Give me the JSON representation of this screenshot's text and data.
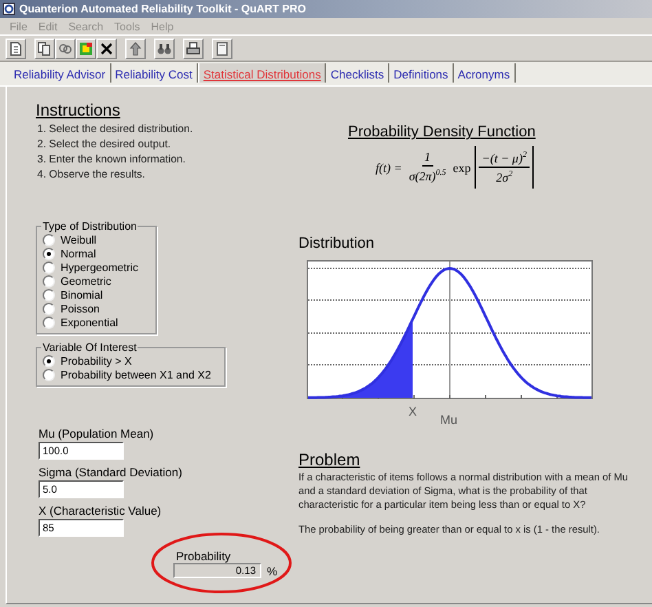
{
  "window": {
    "title": "Quanterion Automated Reliability Toolkit - QuART PRO"
  },
  "menu": [
    {
      "label": "File",
      "disabled": true
    },
    {
      "label": "Edit",
      "disabled": true
    },
    {
      "label": "Search",
      "disabled": true
    },
    {
      "label": "Tools",
      "disabled": true
    },
    {
      "label": "Help",
      "disabled": true
    }
  ],
  "tabs": [
    {
      "label": "Reliability Advisor",
      "selected": false
    },
    {
      "label": "Reliability Cost",
      "selected": false
    },
    {
      "label": "Statistical Distributions",
      "selected": true
    },
    {
      "label": "Checklists",
      "selected": false
    },
    {
      "label": "Definitions",
      "selected": false
    },
    {
      "label": "Acronyms",
      "selected": false
    }
  ],
  "instructions": {
    "title": "Instructions",
    "steps": [
      "1. Select the desired distribution.",
      "2. Select the desired output.",
      "3. Enter the known information.",
      "4. Observe the results."
    ]
  },
  "distribution_type": {
    "legend": "Type of Distribution",
    "options": [
      {
        "label": "Weibull",
        "selected": false
      },
      {
        "label": "Normal",
        "selected": true
      },
      {
        "label": "Hypergeometric",
        "selected": false
      },
      {
        "label": "Geometric",
        "selected": false
      },
      {
        "label": "Binomial",
        "selected": false
      },
      {
        "label": "Poisson",
        "selected": false
      },
      {
        "label": "Exponential",
        "selected": false
      }
    ]
  },
  "variable_of_interest": {
    "legend": "Variable Of Interest",
    "options": [
      {
        "label": "Probability > X",
        "selected": true
      },
      {
        "label": "Probability between X1 and X2",
        "selected": false
      }
    ]
  },
  "fields": [
    {
      "label": "Mu (Population Mean)",
      "value": "100.0"
    },
    {
      "label": "Sigma (Standard Deviation)",
      "value": "5.0"
    },
    {
      "label": "X (Characteristic Value)",
      "value": "85"
    }
  ],
  "result": {
    "label": "Probability",
    "value": "0.13",
    "unit": "%"
  },
  "formula": {
    "title": "Probability Density Function",
    "lhs": "f(t) =",
    "numerator": "1",
    "denominator": "σ(2π)$^{0.5}$",
    "function": "exp",
    "exp_numerator": "−(t − μ)$^{2}$",
    "exp_denominator": "2σ$^{2}$"
  },
  "distribution": {
    "title": "Distribution",
    "x_label": "X",
    "mean_label": "Mu"
  },
  "problem": {
    "title": "Problem",
    "paragraphs": [
      "If a characteristic of items follows a normal distribution with a mean of Mu and a standard deviation of Sigma, what is the probability of that characteristic for a particular item being less than or equal to X?",
      "The probability of being greater than or equal to x is (1 - the result)."
    ]
  }
}
